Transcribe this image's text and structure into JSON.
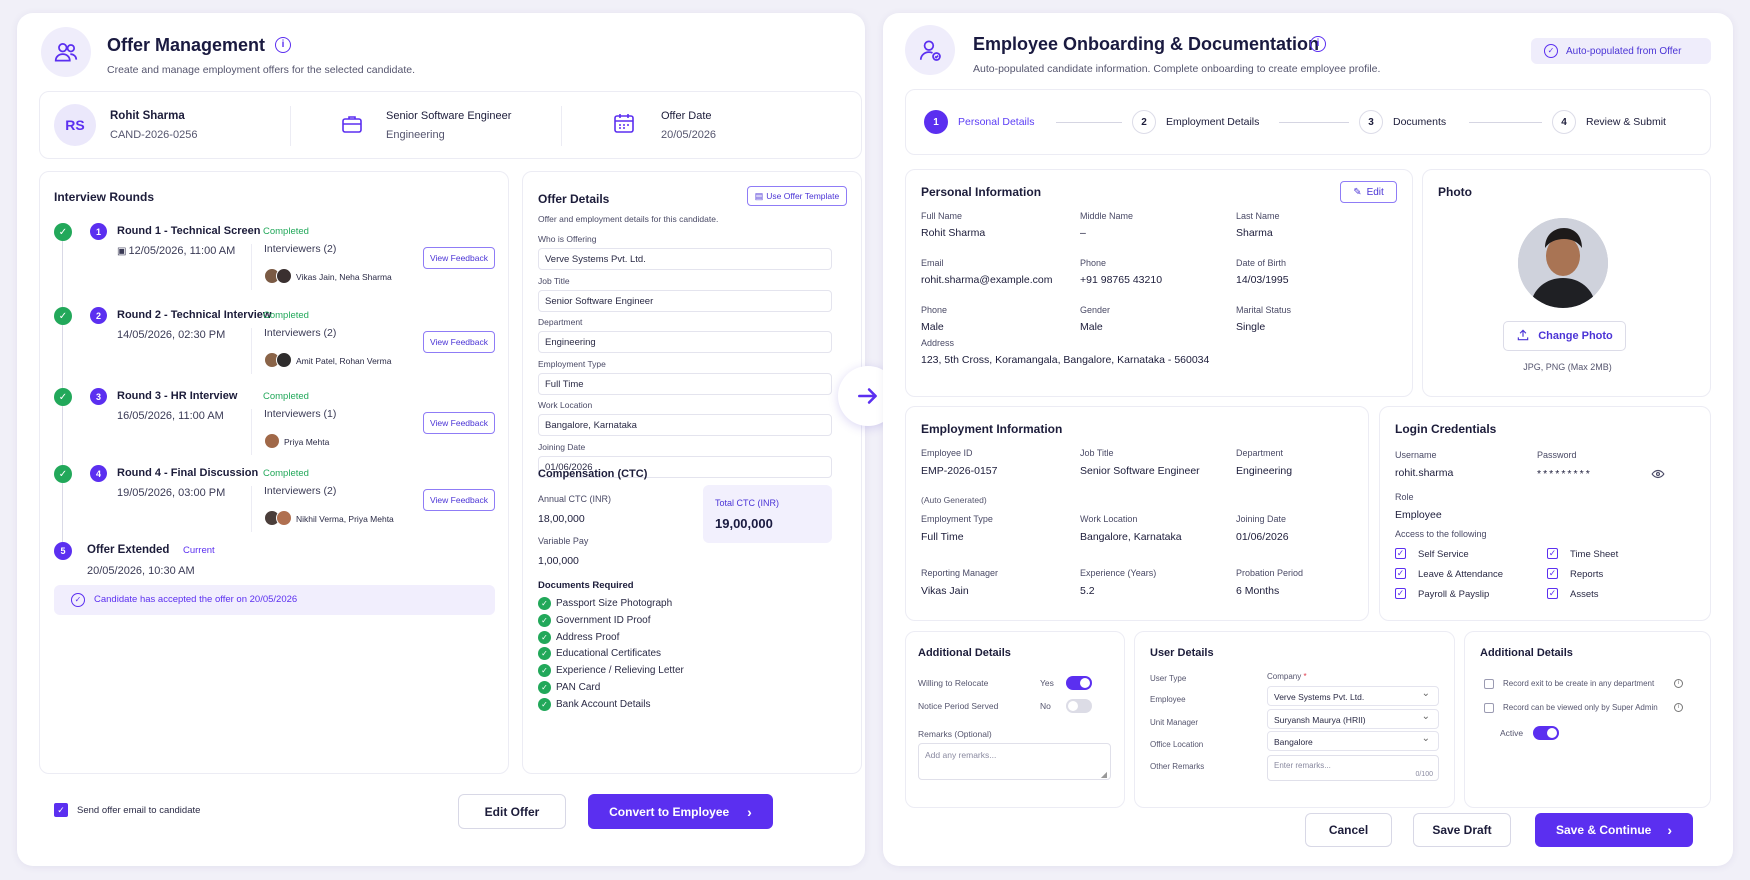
{
  "left": {
    "title": "Offer Management",
    "subtitle": "Create and manage employment offers for the selected candidate.",
    "candidate": {
      "initials": "RS",
      "name": "Rohit Sharma",
      "id": "CAND-2026-0256",
      "role": "Senior Software Engineer",
      "dept": "Engineering",
      "offer_date_label": "Offer Date",
      "offer_date": "20/05/2026"
    },
    "rounds_title": "Interview Rounds",
    "rounds": [
      {
        "num": "1",
        "name": "Round 1 - Technical Screen",
        "status": "Completed",
        "date": "12/05/2026, 11:00 AM",
        "interviewers_label": "Interviewers (2)",
        "interviewers": "Vikas Jain, Neha Sharma",
        "feedback": "View Feedback"
      },
      {
        "num": "2",
        "name": "Round 2 - Technical Interview",
        "status": "Completed",
        "date": "14/05/2026, 02:30 PM",
        "interviewers_label": "Interviewers (2)",
        "interviewers": "Amit Patel, Rohan Verma",
        "feedback": "View Feedback"
      },
      {
        "num": "3",
        "name": "Round 3 - HR Interview",
        "status": "Completed",
        "date": "16/05/2026, 11:00 AM",
        "interviewers_label": "Interviewers (1)",
        "interviewers": "Priya Mehta",
        "feedback": "View Feedback"
      },
      {
        "num": "4",
        "name": "Round 4 - Final Discussion",
        "status": "Completed",
        "date": "19/05/2026, 03:00 PM",
        "interviewers_label": "Interviewers (2)",
        "interviewers": "Nikhil Verma, Priya Mehta",
        "feedback": "View Feedback"
      }
    ],
    "offer_extended": {
      "num": "5",
      "name": "Offer Extended",
      "status": "Current",
      "date": "20/05/2026, 10:30 AM"
    },
    "accepted_note": "Candidate has accepted the offer on 20/05/2026",
    "offer_details": {
      "title": "Offer Details",
      "template_btn": "Use Offer Template",
      "desc": "Offer and employment details for this candidate.",
      "fields": [
        {
          "label": "Who is Offering",
          "value": "Verve Systems Pvt. Ltd."
        },
        {
          "label": "Job Title",
          "value": "Senior Software Engineer"
        },
        {
          "label": "Department",
          "value": "Engineering"
        },
        {
          "label": "Employment Type",
          "value": "Full Time"
        },
        {
          "label": "Work Location",
          "value": "Bangalore, Karnataka"
        },
        {
          "label": "Joining Date",
          "value": "01/06/2026"
        }
      ],
      "comp_title": "Compensation (CTC)",
      "annual_label": "Annual CTC (INR)",
      "annual": "18,00,000",
      "variable_label": "Variable Pay",
      "variable": "1,00,000",
      "total_label": "Total CTC (INR)",
      "total": "19,00,000",
      "docs_title": "Documents Required",
      "docs": [
        "Passport Size Photograph",
        "Government ID Proof",
        "Address Proof",
        "Educational Certificates",
        "Experience / Relieving Letter",
        "PAN Card",
        "Bank Account Details"
      ]
    },
    "send_email": "Send offer email to candidate",
    "edit_offer": "Edit Offer",
    "convert": "Convert to Employee"
  },
  "right": {
    "title": "Employee Onboarding & Documentation",
    "subtitle": "Auto-populated candidate information. Complete onboarding to create employee profile.",
    "auto_badge": "Auto-populated from Offer",
    "steps": [
      {
        "num": "1",
        "label": "Personal Details"
      },
      {
        "num": "2",
        "label": "Employment Details"
      },
      {
        "num": "3",
        "label": "Documents"
      },
      {
        "num": "4",
        "label": "Review & Submit"
      }
    ],
    "personal": {
      "title": "Personal Information",
      "edit": "Edit",
      "fields": [
        {
          "label": "Full Name",
          "value": "Rohit Sharma"
        },
        {
          "label": "Middle Name",
          "value": "–"
        },
        {
          "label": "Last Name",
          "value": "Sharma"
        },
        {
          "label": "Email",
          "value": "rohit.sharma@example.com"
        },
        {
          "label": "Phone",
          "value": "+91 98765 43210"
        },
        {
          "label": "Date of Birth",
          "value": "14/03/1995"
        },
        {
          "label": "Phone",
          "value": "Male"
        },
        {
          "label": "Gender",
          "value": "Male"
        },
        {
          "label": "Marital Status",
          "value": "Single"
        }
      ],
      "address_label": "Address",
      "address": "123, 5th Cross, Koramangala, Bangalore, Karnataka - 560034"
    },
    "photo": {
      "title": "Photo",
      "change": "Change Photo",
      "hint": "JPG, PNG (Max 2MB)"
    },
    "employment": {
      "title": "Employment Information",
      "fields": [
        {
          "label": "Employee ID",
          "value": "EMP-2026-0157"
        },
        {
          "label": "Job Title",
          "value": "Senior Software Engineer"
        },
        {
          "label": "Department",
          "value": "Engineering"
        },
        {
          "label": "Employment Type",
          "value": "Full Time"
        },
        {
          "label": "Work Location",
          "value": "Bangalore, Karnataka"
        },
        {
          "label": "Joining Date",
          "value": "01/06/2026"
        },
        {
          "label": "Reporting Manager",
          "value": "Vikas Jain"
        },
        {
          "label": "Experience (Years)",
          "value": "5.2"
        },
        {
          "label": "Probation Period",
          "value": "6 Months"
        }
      ],
      "auto_gen": "(Auto Generated)"
    },
    "login": {
      "title": "Login Credentials",
      "username_label": "Username",
      "username": "rohit.sharma",
      "password_label": "Password",
      "password": "*********",
      "role_label": "Role",
      "role": "Employee",
      "access_label": "Access to the following",
      "access": [
        "Self Service",
        "Time Sheet",
        "Leave & Attendance",
        "Reports",
        "Payroll & Payslip",
        "Assets"
      ]
    },
    "additional": {
      "title": "Additional Details",
      "relocate": "Willing to Relocate",
      "relocate_val": "Yes",
      "notice": "Notice Period Served",
      "notice_val": "No",
      "remarks_label": "Remarks (Optional)",
      "remarks_ph": "Add any remarks..."
    },
    "user": {
      "title": "User Details",
      "user_type": "User Type",
      "company_label": "Company",
      "employee_label": "Employee",
      "company": "Verve Systems Pvt. Ltd.",
      "unit_label": "Unit Manager",
      "unit": "Suryansh Maurya (HRII)",
      "office_label": "Office Location",
      "office": "Bangalore",
      "other_label": "Other Remarks",
      "other_ph": "Enter remarks...",
      "counter": "0/100"
    },
    "additional2": {
      "title": "Additional Details",
      "opt1": "Record exit to be create in any department",
      "opt2": "Record can be viewed only by Super Admin",
      "active": "Active"
    },
    "cancel": "Cancel",
    "save_draft": "Save Draft",
    "save_continue": "Save & Continue"
  }
}
